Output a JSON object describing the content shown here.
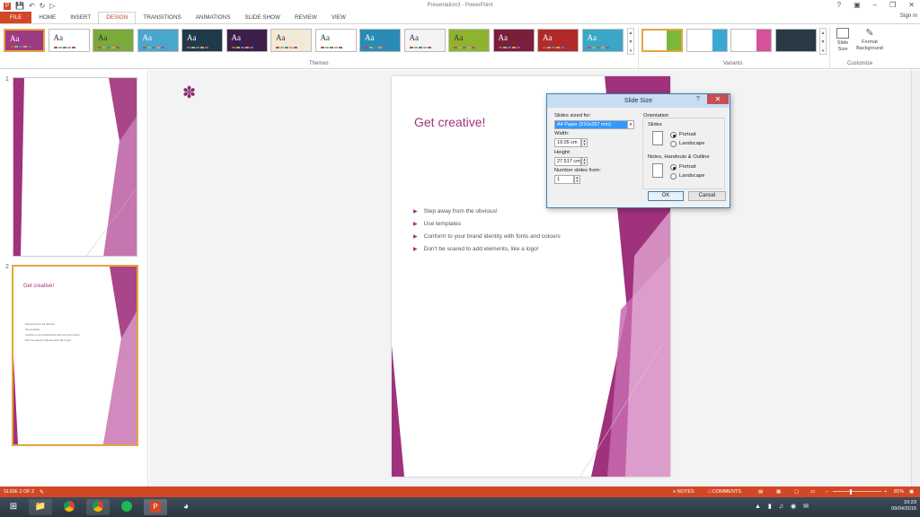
{
  "window": {
    "title": "Presentation3 - PowerPoint",
    "sign_in": "Sign in"
  },
  "quick_access": {
    "icons": [
      "powerpoint-icon",
      "save-icon",
      "undo-icon",
      "redo-icon",
      "start-from-beginning-icon"
    ]
  },
  "tabs": [
    "FILE",
    "HOME",
    "INSERT",
    "DESIGN",
    "TRANSITIONS",
    "ANIMATIONS",
    "SLIDE SHOW",
    "REVIEW",
    "VIEW"
  ],
  "active_tab": "DESIGN",
  "ribbon": {
    "themes_label": "Themes",
    "variants_label": "Variants",
    "customize_label": "Customize",
    "slide_size_label": "Slide Size",
    "format_background_label": "Format Background",
    "theme_sample_text": "Aa",
    "theme_colors": [
      "#9c3a82",
      "#ffffff",
      "#7aaa3a",
      "#4aa6cc",
      "#1f3a4a",
      "#3c1e4a",
      "#f3e9d8",
      "#ffffff",
      "#2a8bb6",
      "#f4f4f4",
      "#8fb32e",
      "#7a1e3c",
      "#b02a2a",
      "#3aa7c6"
    ],
    "variant_colors": [
      "#7ab83a",
      "#3aa7d6",
      "#d8509a",
      "#2a3a44"
    ]
  },
  "thumbnails": [
    {
      "number": "1",
      "title": ""
    },
    {
      "number": "2",
      "title": "Get creative!",
      "bullets": [
        "Step away from the obvious!",
        "Use templates",
        "Conform to your brand identity with fonts and colours",
        "Don't be scared to add elements, like a logo!"
      ]
    }
  ],
  "slide": {
    "title": "Get creative!",
    "bullets": [
      "Step away from the obvious!",
      "Use templates",
      "Conform to your brand identity with fonts and colours",
      "Don't be scared to add elements, like a logo!"
    ],
    "accent_color": "#a0317c",
    "flower_glyph": "✽"
  },
  "dialog": {
    "title": "Slide Size",
    "help": "?",
    "close": "✕",
    "slides_sized_for_label": "Slides sized for:",
    "slides_sized_for_value": "A4 Paper (210x297 mm)",
    "width_label": "Width:",
    "width_value": "19.05 cm",
    "height_label": "Height:",
    "height_value": "27.517 cm",
    "number_from_label": "Number slides from:",
    "number_from_value": "1",
    "orientation_label": "Orientation",
    "slides_group_label": "Slides",
    "notes_group_label": "Notes, Handouts & Outline",
    "portrait_label": "Portrait",
    "landscape_label": "Landscape",
    "ok_label": "OK",
    "cancel_label": "Cancel"
  },
  "statusbar": {
    "slide_info": "SLIDE 2 OF 2",
    "notes": "NOTES",
    "comments": "COMMENTS",
    "zoom": "81%"
  },
  "taskbar": {
    "time": "10:23",
    "date": "09/04/2015",
    "apps": [
      "windows-start-icon",
      "file-explorer-icon",
      "chrome-icon",
      "chrome-icon",
      "spotify-icon",
      "powerpoint-icon",
      "app-icon"
    ]
  }
}
